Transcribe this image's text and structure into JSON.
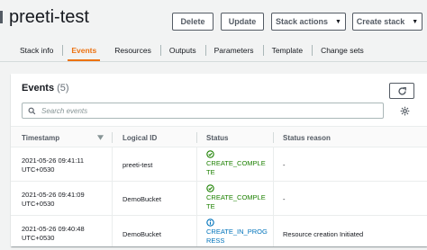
{
  "page": {
    "title": "preeti-test"
  },
  "actions": {
    "delete": "Delete",
    "update": "Update",
    "stack_actions": "Stack actions",
    "create_stack": "Create stack"
  },
  "tabs": [
    {
      "label": "Stack info"
    },
    {
      "label": "Events"
    },
    {
      "label": "Resources"
    },
    {
      "label": "Outputs"
    },
    {
      "label": "Parameters"
    },
    {
      "label": "Template"
    },
    {
      "label": "Change sets"
    }
  ],
  "active_tab": "Events",
  "events": {
    "title": "Events",
    "count": "(5)",
    "search_placeholder": "Search events",
    "columns": {
      "timestamp": "Timestamp",
      "logical_id": "Logical ID",
      "status": "Status",
      "status_reason": "Status reason"
    },
    "rows": [
      {
        "timestamp_line1": "2021-05-26 09:41:11",
        "timestamp_line2": "UTC+0530",
        "logical_id": "preeti-test",
        "status_line1": "CREATE_COMPLE",
        "status_line2": "TE",
        "status_reason": "-"
      },
      {
        "timestamp_line1": "2021-05-26 09:41:09",
        "timestamp_line2": "UTC+0530",
        "logical_id": "DemoBucket",
        "status_line1": "CREATE_COMPLE",
        "status_line2": "TE",
        "status_reason": "-"
      },
      {
        "timestamp_line1": "2021-05-26 09:40:48",
        "timestamp_line2": "UTC+0530",
        "logical_id": "DemoBucket",
        "status_line1": "CREATE_IN_PROG",
        "status_line2": "RESS",
        "status_reason": "Resource creation Initiated"
      }
    ]
  },
  "colors": {
    "accent": "#ec7211",
    "success": "#1d8102",
    "info": "#0073bb"
  }
}
